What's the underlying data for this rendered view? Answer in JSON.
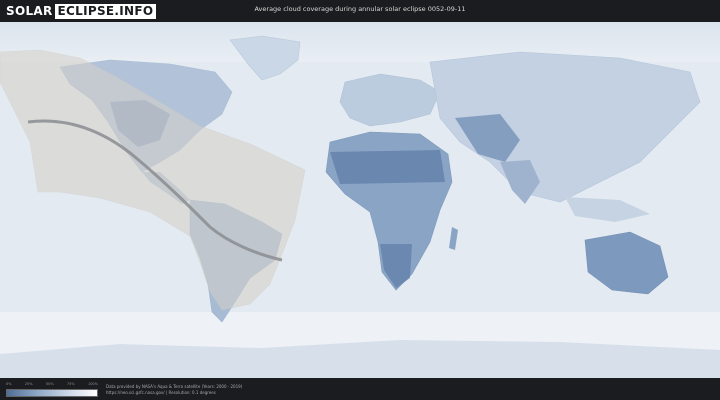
{
  "header": {
    "logo_part1": "SOLAR",
    "logo_part2": "ECLIPSE.INFO",
    "title": "Average cloud coverage during annular solar eclipse 0052-09-11"
  },
  "legend": {
    "ticks": [
      "0%",
      "25%",
      "50%",
      "75%",
      "100%"
    ],
    "colors": {
      "low": "#4f6e97",
      "mid": "#8ea7c6",
      "high": "#ffffff"
    }
  },
  "footer": {
    "credit_line1": "Data provided by NASA's Aqua & Terra satellite (Years: 2000 - 2019)",
    "credit_line2": "https://neo.sci.gsfc.nasa.gov/ | Resolution: 0.1 degrees"
  },
  "colors": {
    "background": "#1e1f22",
    "ocean_cloud": "#e9eef4",
    "land_clear": "#7d97bb",
    "shadow": "#d6d3cd",
    "central_line": "#8a8c8f"
  }
}
